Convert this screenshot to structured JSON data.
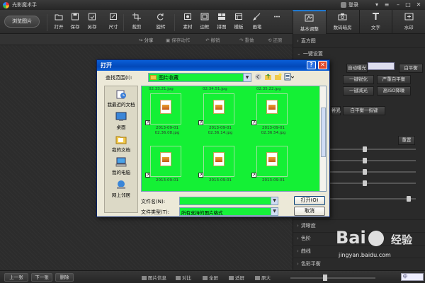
{
  "app": {
    "title": "光影魔术手",
    "login": "登录"
  },
  "toolbar": {
    "browse": "浏览图片",
    "tools": [
      "打开",
      "保存",
      "另存",
      "尺寸",
      "裁剪",
      "旋转",
      "素材",
      "边框",
      "拼图",
      "模板",
      "画笔"
    ]
  },
  "right_tabs": [
    "基本调整",
    "数码暗房",
    "文字",
    "水印"
  ],
  "actionbar": {
    "share": "分享",
    "save_action": "保存动作",
    "undo": "撤销",
    "redo": "重做",
    "restore": "还原"
  },
  "panel": {
    "sections_top": [
      "直方图",
      "一键设置"
    ],
    "buttons": [
      "自动曝光",
      "白平衡",
      "一键锐化",
      "严重白平衡",
      "一键减光",
      "高ISO降噪",
      "补光",
      "白平衡一指键"
    ],
    "reset": "重置",
    "sections_bottom": [
      "清晰度",
      "色阶",
      "曲线",
      "色彩平衡"
    ]
  },
  "bottom": {
    "prev": "上一张",
    "next": "下一张",
    "delete": "删除",
    "info": "图片信息",
    "compare": "对比",
    "fullscreen": "全屏",
    "fit": "适屏",
    "original": "原大"
  },
  "dialog": {
    "title": "打开",
    "look_in_label": "查找范围(I):",
    "look_in_value": "图片收藏",
    "places": [
      "我最近的文档",
      "桌面",
      "我的文档",
      "我的电脑",
      "网上邻居"
    ],
    "top_names": [
      "02.33.21.jpg",
      "02.34.51.jpg",
      "02.35.22.jpg"
    ],
    "files": [
      {
        "date": "2013-09-01",
        "time": "02.36.08.jpg"
      },
      {
        "date": "2013-09-01",
        "time": "02.36.14.jpg"
      },
      {
        "date": "2013-09-01",
        "time": "02.36.54.jpg"
      },
      {
        "date": "2013-09-01",
        "time": ""
      },
      {
        "date": "2013-09-01",
        "time": ""
      },
      {
        "date": "2013-09-01",
        "time": ""
      }
    ],
    "filename_label": "文件名(N):",
    "filetype_label": "文件类型(T):",
    "filetype_value": "所有支持的图片格式",
    "open_btn": "打开(O)",
    "cancel_btn": "取消"
  },
  "watermark": {
    "brand": "Bai",
    "brand_cn": "经验",
    "url": "jingyan.baidu.com"
  },
  "ime": "中"
}
